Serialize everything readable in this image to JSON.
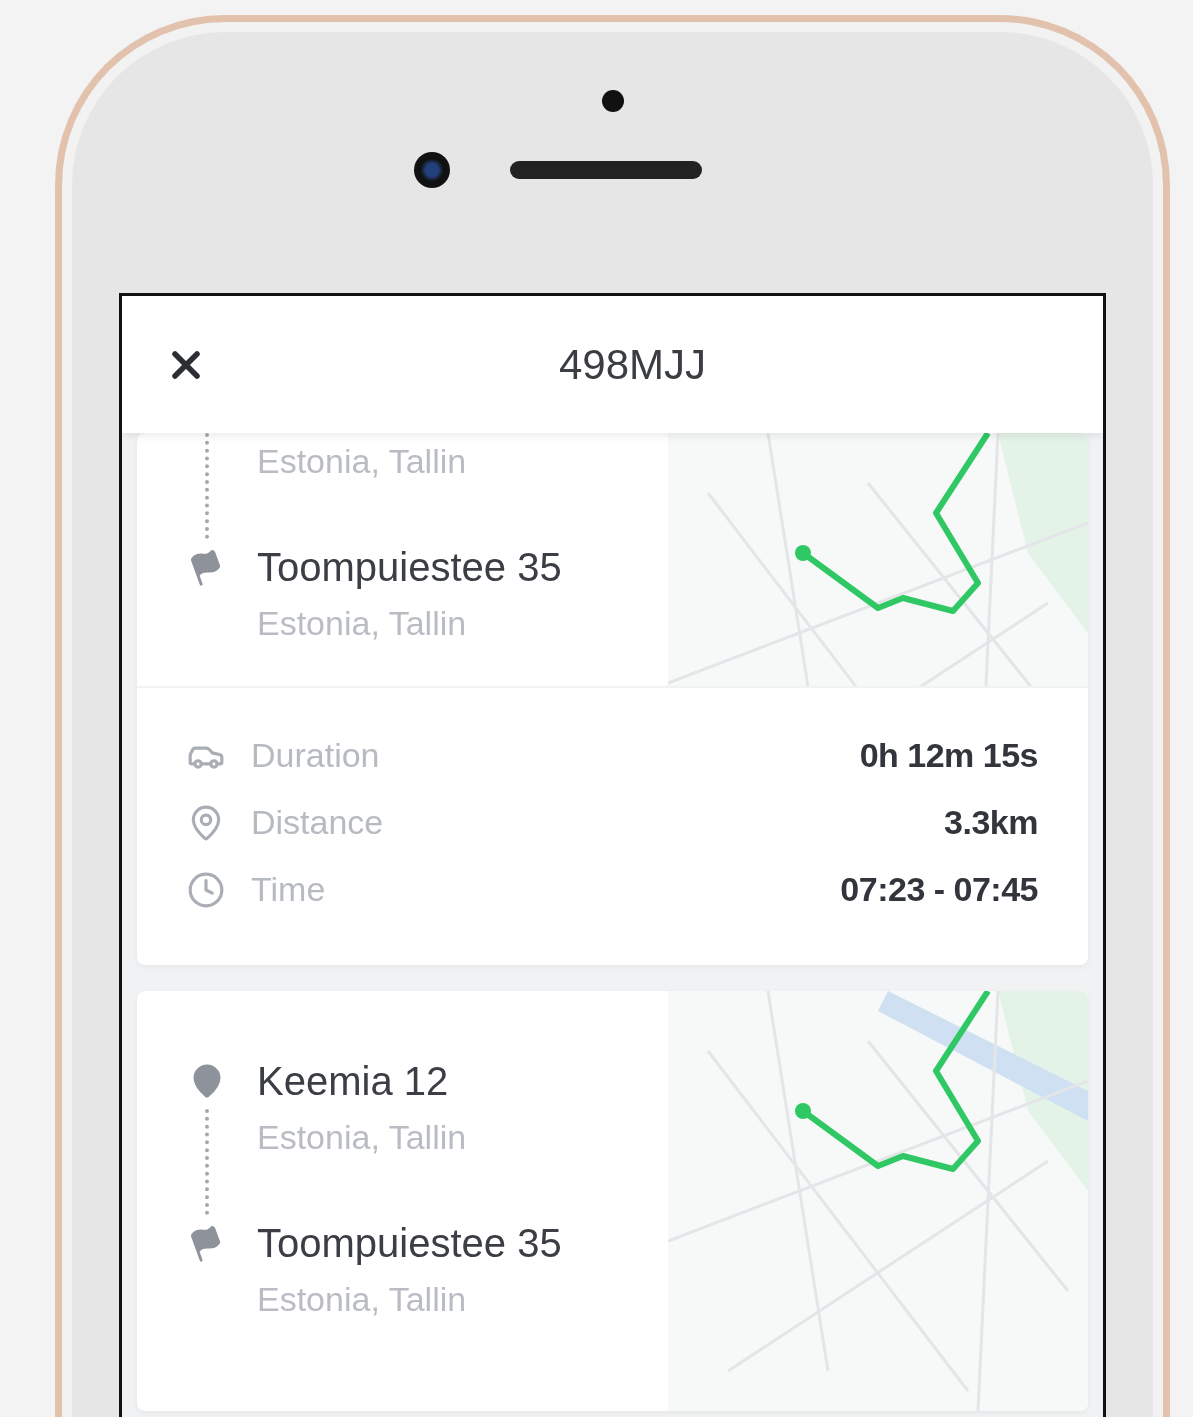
{
  "header": {
    "title": "498MJJ"
  },
  "trips": [
    {
      "stops": [
        {
          "kind": "origin",
          "city": "Estonia, Tallin"
        },
        {
          "kind": "destination",
          "name": "Toompuiestee 35",
          "city": "Estonia, Tallin"
        }
      ],
      "stats": [
        {
          "kind": "duration",
          "label": "Duration",
          "value": "0h 12m 15s"
        },
        {
          "kind": "distance",
          "label": "Distance",
          "value": "3.3km"
        },
        {
          "kind": "time",
          "label": "Time",
          "value": "07:23 - 07:45"
        }
      ]
    },
    {
      "stops": [
        {
          "kind": "origin",
          "name": "Keemia 12",
          "city": "Estonia, Tallin"
        },
        {
          "kind": "destination",
          "name": "Toompuiestee 35",
          "city": "Estonia, Tallin"
        }
      ]
    }
  ]
}
